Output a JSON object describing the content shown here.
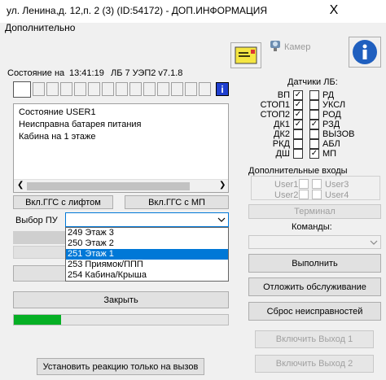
{
  "window": {
    "title": "ул. Ленина,д. 12,п. 2 (3) (ID:54172) - ДОП.ИНФОРМАЦИЯ",
    "close_glyph": "X",
    "menu": "Дополнительно"
  },
  "toolbar": {
    "camera_label": "Камер"
  },
  "status": {
    "label": "Состояние на",
    "time": "13:41:19",
    "version": "ЛБ 7 УЭП2 v7.1.8",
    "info_glyph": "i",
    "lines": [
      "Состояние USER1",
      "Неисправна батарея питания",
      "Кабина на 1 этаже"
    ]
  },
  "sensors": {
    "title": "Датчики ЛБ:",
    "left": [
      {
        "label": "ВП",
        "checked": true
      },
      {
        "label": "СТОП1",
        "checked": true
      },
      {
        "label": "СТОП2",
        "checked": true
      },
      {
        "label": "ДК1",
        "checked": true
      },
      {
        "label": "ДК2",
        "checked": false
      },
      {
        "label": "РКД",
        "checked": false
      },
      {
        "label": "ДШ",
        "checked": false
      }
    ],
    "right": [
      {
        "label": "РД",
        "checked": false
      },
      {
        "label": "УКСЛ",
        "checked": false
      },
      {
        "label": "РОД",
        "checked": false
      },
      {
        "label": "РЗД",
        "checked": true
      },
      {
        "label": "ВЫЗОВ",
        "checked": false
      },
      {
        "label": "АБЛ",
        "checked": false
      },
      {
        "label": "МП",
        "checked": true
      }
    ]
  },
  "extra_inputs": {
    "title": "Дополнительные входы",
    "items": [
      "User1",
      "User2",
      "User3",
      "User4"
    ]
  },
  "buttons": {
    "ggs_lift": "Вкл.ГГС с лифтом",
    "ggs_mp": "Вкл.ГГС с МП",
    "terminal": "Терминал",
    "close": "Закрыть",
    "execute": "Выполнить",
    "cancel_service": "Отложить обслуживание",
    "reset_faults": "Сброс неисправностей",
    "output1": "Включить Выход 1",
    "output2": "Включить Выход 2",
    "call_only": "Установить реакцию только на вызов"
  },
  "floor_select": {
    "label": "Выбор ПУ",
    "options": [
      "249 Этаж 3",
      "250 Этаж 2",
      "251 Этаж 1",
      "253 Приямок/ППП",
      "254 Кабина/Крыша"
    ],
    "selected_index": 2
  },
  "commands": {
    "label": "Команды:"
  },
  "progress": {
    "fraction": 0.22,
    "color": "#06b025"
  }
}
